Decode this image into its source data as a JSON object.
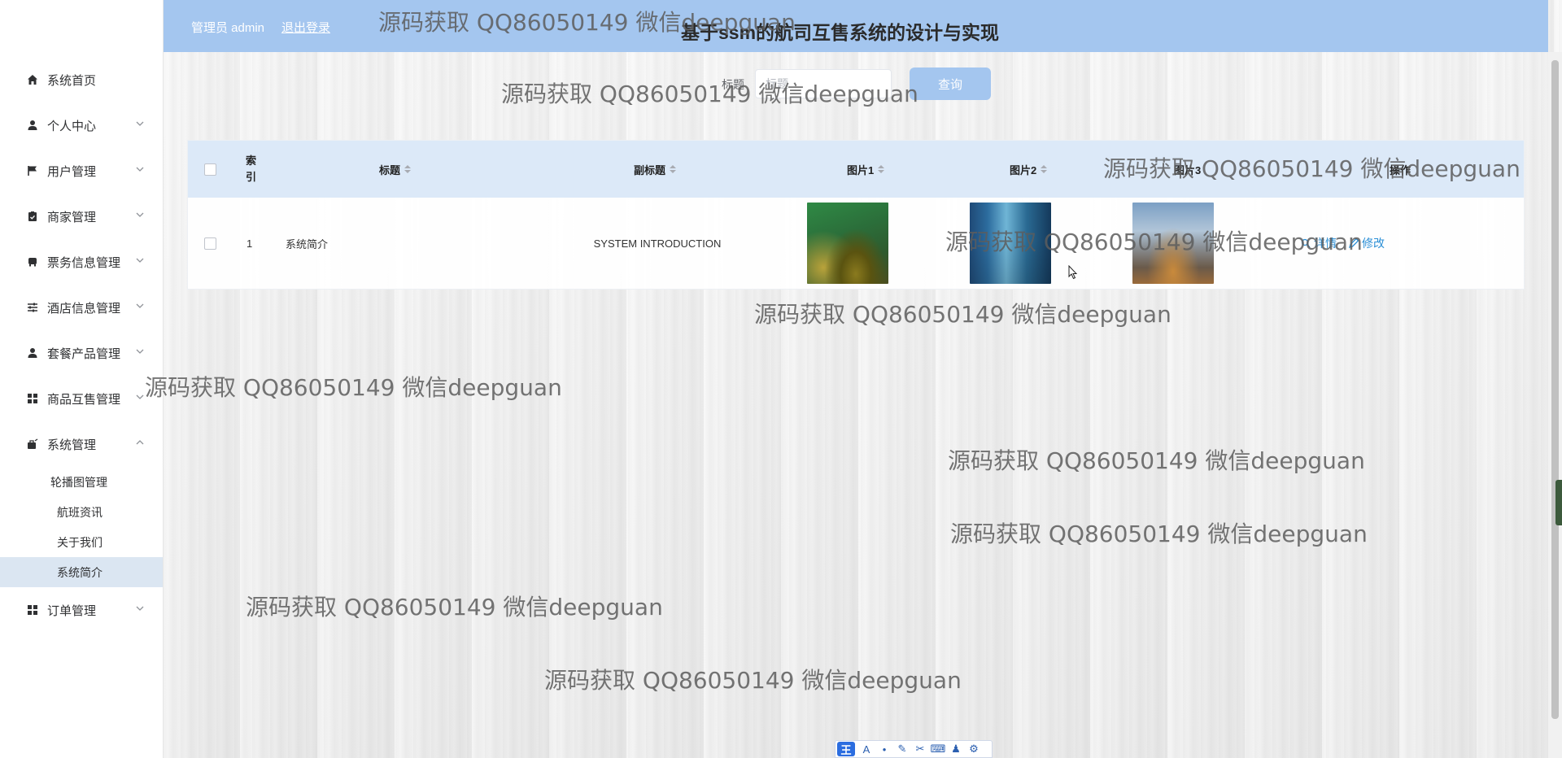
{
  "header": {
    "admin_text": "管理员 admin",
    "logout_label": "退出登录",
    "title": "基于ssm的航司互售系统的设计与实现"
  },
  "sidebar": {
    "items": [
      {
        "label": "系统首页",
        "icon": "home-icon",
        "has_arrow": false
      },
      {
        "label": "个人中心",
        "icon": "user-icon",
        "has_arrow": true,
        "arrow": "down"
      },
      {
        "label": "用户管理",
        "icon": "flag-icon",
        "has_arrow": true,
        "arrow": "down"
      },
      {
        "label": "商家管理",
        "icon": "clipboard-check-icon",
        "has_arrow": true,
        "arrow": "down"
      },
      {
        "label": "票务信息管理",
        "icon": "ticket-icon",
        "has_arrow": true,
        "arrow": "down"
      },
      {
        "label": "酒店信息管理",
        "icon": "sliders-icon",
        "has_arrow": true,
        "arrow": "down"
      },
      {
        "label": "套餐产品管理",
        "icon": "person-icon",
        "has_arrow": true,
        "arrow": "down"
      },
      {
        "label": "商品互售管理",
        "icon": "grid-icon",
        "has_arrow": true,
        "arrow": "down"
      },
      {
        "label": "系统管理",
        "icon": "briefcase-icon",
        "has_arrow": true,
        "arrow": "up"
      }
    ],
    "system_submenu": [
      {
        "label": "轮播图管理",
        "active": false
      },
      {
        "label": "航班资讯",
        "active": false
      },
      {
        "label": "关于我们",
        "active": false
      },
      {
        "label": "系统简介",
        "active": true
      }
    ],
    "last_item": {
      "label": "订单管理",
      "icon": "grid-icon",
      "arrow": "down"
    }
  },
  "search": {
    "label": "标题",
    "placeholder": "标题",
    "button_label": "查询"
  },
  "table": {
    "columns": {
      "index": "索引",
      "title": "标题",
      "subtitle": "副标题",
      "image1": "图片1",
      "image2": "图片2",
      "image3": "图片3",
      "actions": "操作"
    },
    "rows": [
      {
        "index": "1",
        "title": "系统简介",
        "subtitle": "SYSTEM INTRODUCTION",
        "actions": {
          "detail": "详情",
          "edit": "修改"
        }
      }
    ]
  },
  "watermark_text": "源码获取 QQ86050149 微信deepguan",
  "colors": {
    "header_bg": "#a4c6ef",
    "table_header_bg": "#dce9f8",
    "active_submenu_bg": "#dbe6f2",
    "link": "#2b8fd6"
  }
}
